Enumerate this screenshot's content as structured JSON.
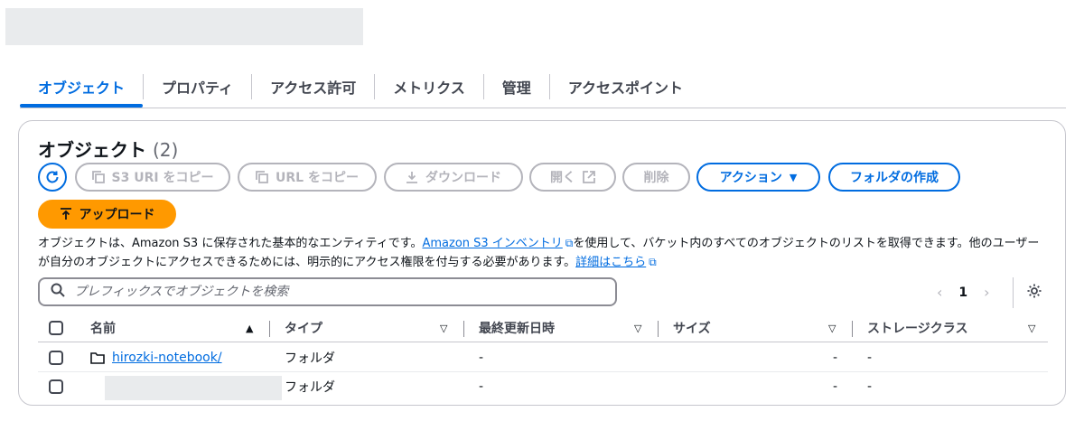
{
  "tabs": [
    {
      "label": "オブジェクト"
    },
    {
      "label": "プロパティ"
    },
    {
      "label": "アクセス許可"
    },
    {
      "label": "メトリクス"
    },
    {
      "label": "管理"
    },
    {
      "label": "アクセスポイント"
    }
  ],
  "panel": {
    "title": "オブジェクト",
    "count": "(2)"
  },
  "toolbar": {
    "copy_s3_uri": "S3 URI をコピー",
    "copy_url": "URL をコピー",
    "download": "ダウンロード",
    "open": "開く",
    "delete": "削除",
    "actions": "アクション",
    "create_folder": "フォルダの作成",
    "upload": "アップロード"
  },
  "description": {
    "part1": "オブジェクトは、Amazon S3 に保存された基本的なエンティティです。",
    "link1": "Amazon S3 インベントリ",
    "part2": "を使用して、バケット内のすべてのオブジェクトのリストを取得できます。他のユーザーが自分のオブジェクトにアクセスできるためには、明示的にアクセス権限を付与する必要があります。",
    "link2": "詳細はこちら"
  },
  "search": {
    "placeholder": "プレフィックスでオブジェクトを検索"
  },
  "pagination": {
    "current_page": "1"
  },
  "table": {
    "columns": [
      "名前",
      "タイプ",
      "最終更新日時",
      "サイズ",
      "ストレージクラス"
    ],
    "rows": [
      {
        "name": "hirozki-notebook/",
        "type": "フォルダ",
        "last_modified": "-",
        "size": "-",
        "storage_class": "-"
      },
      {
        "name": "",
        "type": "フォルダ",
        "last_modified": "-",
        "size": "-",
        "storage_class": "-"
      }
    ]
  },
  "colors": {
    "accent": "#006ce0",
    "upload": "#ff9900",
    "disabled": "#b4b4bb"
  }
}
